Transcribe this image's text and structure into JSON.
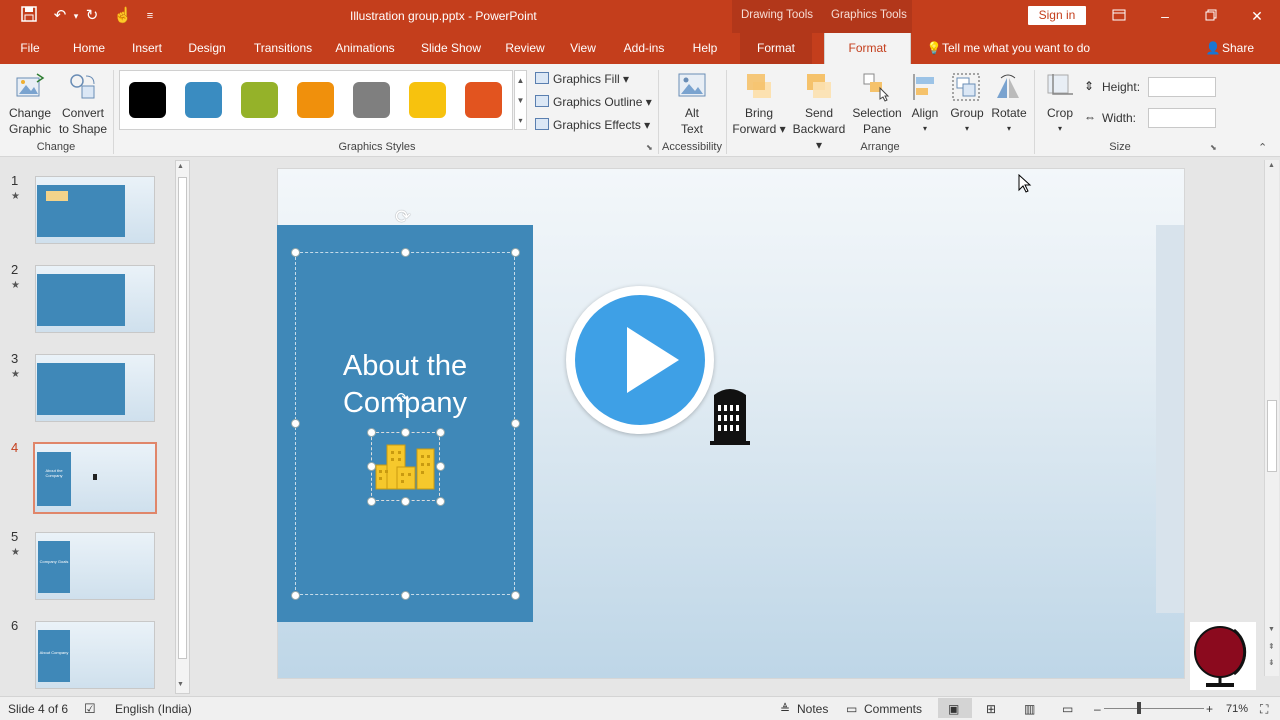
{
  "title_bar": {
    "document_title": "Illustration group.pptx - PowerPoint",
    "contextual_tab_groups": [
      "Drawing Tools",
      "Graphics Tools"
    ],
    "sign_in_label": "Sign in",
    "quick_access_icons": [
      "save-icon",
      "undo-icon",
      "redo-icon",
      "touch-mode-icon",
      "customize-icon"
    ],
    "window_icons": [
      "ribbon-display-icon",
      "minimize-icon",
      "restore-icon",
      "close-icon"
    ]
  },
  "tabs": [
    {
      "label": "File"
    },
    {
      "label": "Home"
    },
    {
      "label": "Insert"
    },
    {
      "label": "Design"
    },
    {
      "label": "Transitions"
    },
    {
      "label": "Animations"
    },
    {
      "label": "Slide Show"
    },
    {
      "label": "Review"
    },
    {
      "label": "View"
    },
    {
      "label": "Add-ins"
    },
    {
      "label": "Help"
    },
    {
      "label": "Format"
    },
    {
      "label": "Format",
      "active": true
    }
  ],
  "tell_me": "Tell me what you want to do",
  "share_label": "Share",
  "ribbon": {
    "change_group": {
      "label": "Change",
      "change_graphic": [
        "Change",
        "Graphic"
      ],
      "convert": [
        "Convert",
        "to Shape"
      ]
    },
    "styles_group": {
      "label": "Graphics Styles",
      "swatches": [
        "#000000",
        "#3a8cc1",
        "#95b229",
        "#f0900c",
        "#7f7f7f",
        "#f7c20e",
        "#e2541f"
      ],
      "fill": "Graphics Fill",
      "outline": "Graphics Outline",
      "effects": "Graphics Effects"
    },
    "accessibility_group": {
      "label": "Accessibility",
      "alt": [
        "Alt",
        "Text"
      ]
    },
    "arrange_group": {
      "label": "Arrange",
      "bring_forward": [
        "Bring",
        "Forward"
      ],
      "send_backward": [
        "Send",
        "Backward"
      ],
      "selection_pane": [
        "Selection",
        "Pane"
      ],
      "align": "Align",
      "group": "Group",
      "rotate": "Rotate"
    },
    "size_group": {
      "label": "Size",
      "crop": "Crop",
      "height_label": "Height:",
      "width_label": "Width:",
      "height_value": "",
      "width_value": ""
    }
  },
  "thumbnails": [
    {
      "number": "1",
      "star": "★"
    },
    {
      "number": "2",
      "star": "★"
    },
    {
      "number": "3",
      "star": "★"
    },
    {
      "number": "4",
      "star": ""
    },
    {
      "number": "5",
      "star": "★"
    },
    {
      "number": "6",
      "star": ""
    }
  ],
  "thumbnail_text": {
    "t4": "About the Company",
    "t5": "Company Goals",
    "t6": "About Company"
  },
  "slide": {
    "heading_line1": "About the",
    "heading_line2": "Company",
    "panel_color": "#3f88b8",
    "play_color": "#3ea0e6"
  },
  "status": {
    "slide_info": "Slide 4 of 6",
    "language": "English (India)",
    "notes": "Notes",
    "comments": "Comments",
    "zoom": "71%"
  },
  "colors": {
    "accent": "#c43e1c",
    "ribbon": "#f3f3f3"
  }
}
